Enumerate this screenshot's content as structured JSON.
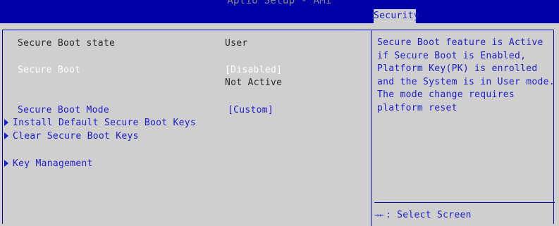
{
  "header": {
    "title": "Aptio Setup - AMI",
    "active_tab": "Security"
  },
  "settings": {
    "secure_boot_state": {
      "label": "Secure Boot state",
      "value": "User"
    },
    "secure_boot": {
      "label": "Secure Boot",
      "value": "[Disabled]",
      "status": "Not Active"
    },
    "secure_boot_mode": {
      "label": "Secure Boot Mode",
      "value": "[Custom]"
    },
    "submenus": [
      {
        "label": "Install Default Secure Boot Keys",
        "icon": "triangle-right-icon"
      },
      {
        "label": "Clear Secure Boot Keys",
        "icon": "triangle-right-icon"
      },
      {
        "label": "Key Management",
        "icon": "triangle-right-icon"
      }
    ]
  },
  "help": {
    "lines": [
      "Secure Boot feature is Active",
      "if Secure Boot is Enabled,",
      "Platform Key(PK) is enrolled",
      "and the System is in User mode.",
      "The mode change requires",
      "platform reset"
    ],
    "key_hint": {
      "key": "→←",
      "text": ": Select Screen"
    }
  },
  "colors": {
    "header_bg": "#0000a8",
    "panel_bg": "#cfcfcf",
    "text_blue": "#1c1ccc",
    "text_dark": "#2b2b2b",
    "text_highlight": "#ffffff"
  }
}
